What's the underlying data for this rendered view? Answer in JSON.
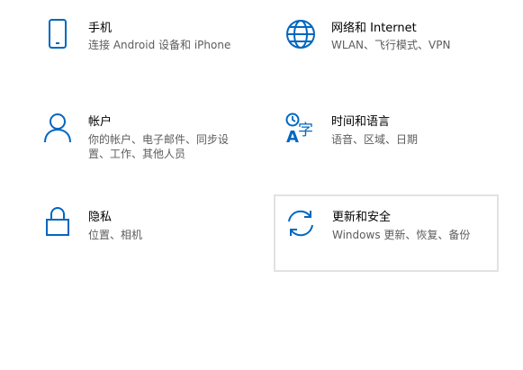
{
  "accent_color": "#0067c0",
  "tiles": [
    {
      "icon": "phone-icon",
      "title": "手机",
      "desc": "连接 Android 设备和 iPhone"
    },
    {
      "icon": "globe-icon",
      "title": "网络和 Internet",
      "desc": "WLAN、飞行模式、VPN"
    },
    {
      "icon": "person-icon",
      "title": "帐户",
      "desc": "你的帐户、电子邮件、同步设置、工作、其他人员"
    },
    {
      "icon": "language-icon",
      "title": "时间和语言",
      "desc": "语音、区域、日期"
    },
    {
      "icon": "lock-icon",
      "title": "隐私",
      "desc": "位置、相机"
    },
    {
      "icon": "sync-icon",
      "title": "更新和安全",
      "desc": "Windows 更新、恢复、备份"
    }
  ]
}
